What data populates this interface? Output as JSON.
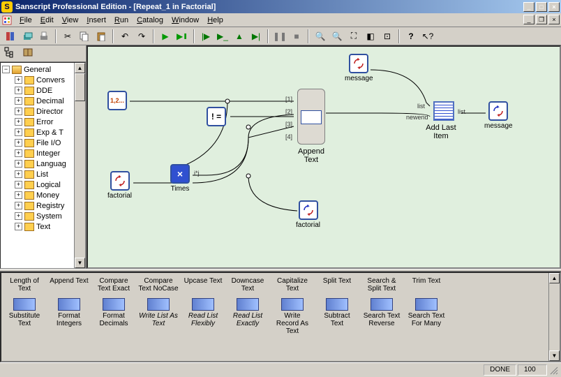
{
  "window": {
    "title": "Sanscript Professional Edition - [Repeat_1 in Factorial]"
  },
  "menubar": [
    "File",
    "Edit",
    "View",
    "Insert",
    "Run",
    "Catalog",
    "Window",
    "Help"
  ],
  "toolbar_icons": [
    "book",
    "stack",
    "print",
    "cut",
    "copy",
    "paste",
    "undo",
    "redo",
    "play",
    "play-pause",
    "run-start",
    "run-step",
    "run-over",
    "run-stop",
    "pause",
    "stop",
    "zoom-in",
    "zoom-out",
    "zoom-fit",
    "zoom-region",
    "zoom-actual",
    "help-cursor"
  ],
  "sidebar": {
    "root": "General",
    "items": [
      "Convers",
      "DDE",
      "Decimal",
      "Director",
      "Error",
      "Exp & T",
      "File I/O",
      "Integer",
      "Languag",
      "List",
      "Logical",
      "Money",
      "Registry",
      "System",
      "Text"
    ]
  },
  "canvas": {
    "nodes": {
      "input_const": {
        "label": "1,2..."
      },
      "notequal": {
        "label": "! ="
      },
      "factorial_in": {
        "label": "factorial"
      },
      "times": {
        "label": "Times",
        "op": "×",
        "out": "i*j"
      },
      "append": {
        "label": "Append Text",
        "ports": [
          "[1]",
          "[2]",
          "[3]",
          "[4]"
        ]
      },
      "factorial_out": {
        "label": "factorial"
      },
      "message_top": {
        "label": "message"
      },
      "addlast": {
        "label": "Add Last Item",
        "ports_in": [
          "list",
          "newend"
        ],
        "ports_out": [
          "list"
        ]
      },
      "message_out": {
        "label": "message"
      }
    }
  },
  "palette_top": [
    "Length of Text",
    "Append Text",
    "Compare Text Exact",
    "Compare Text NoCase",
    "Upcase Text",
    "Downcase Text",
    "Capitalize Text",
    "Split Text",
    "Search & Split Text",
    "Trim Text"
  ],
  "palette_bottom": [
    "Substitute Text",
    "Format Integers",
    "Format Decimals",
    "Write List As Text",
    "Read List Flexibly",
    "Read List Exactly",
    "Write Record As Text",
    "Subtract Text",
    "Search Text Reverse",
    "Search Text For Many"
  ],
  "palette_italic": [
    3,
    4,
    5
  ],
  "status": {
    "done": "DONE",
    "pct": "100"
  }
}
